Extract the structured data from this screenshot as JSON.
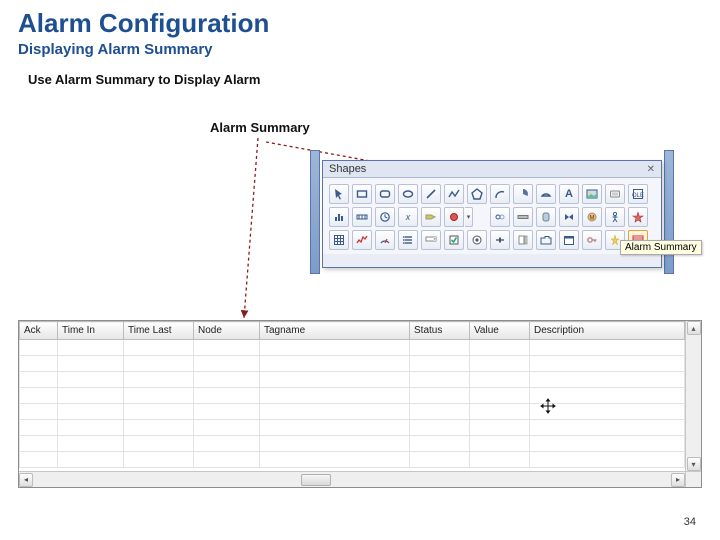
{
  "title": "Alarm Configuration",
  "subtitle": "Displaying Alarm Summary",
  "instruction": "Use Alarm Summary to Display Alarm",
  "label": "Alarm Summary",
  "page_number": "34",
  "shapes_panel": {
    "title": "Shapes",
    "tooltip": "Alarm Summary"
  },
  "alarm_table": {
    "columns": [
      "Ack",
      "Time In",
      "Time Last",
      "Node",
      "Tagname",
      "Status",
      "Value",
      "Description"
    ]
  }
}
